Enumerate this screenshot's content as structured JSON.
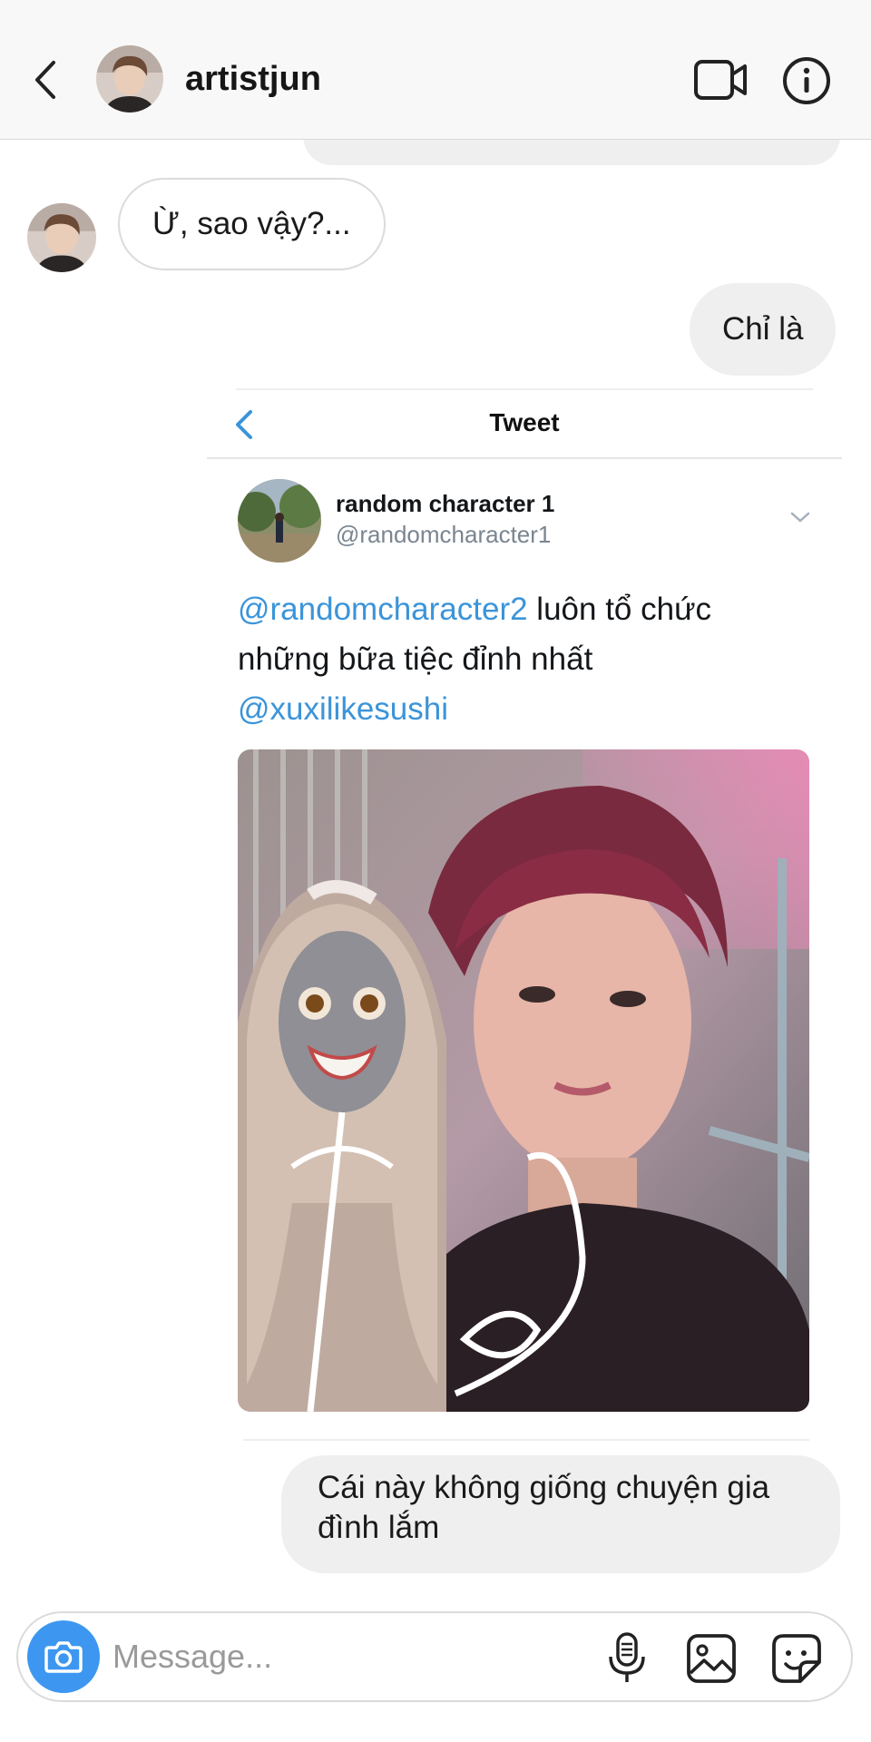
{
  "header": {
    "username": "artistjun",
    "back_icon": "chevron-left-icon",
    "video_icon": "video-call-icon",
    "info_icon": "info-icon"
  },
  "messages": [
    {
      "direction": "incoming",
      "text": "Ừ, sao vậy?..."
    },
    {
      "direction": "outgoing",
      "text": "Chỉ là"
    },
    {
      "direction": "outgoing",
      "text": "Cái này không giống chuyện gia đình lắm"
    }
  ],
  "tweet": {
    "nav_title": "Tweet",
    "display_name": "random character 1",
    "handle": "@randomcharacter1",
    "mention1": "@randomcharacter2",
    "text_part1": " luôn tổ chức những bữa tiệc đỉnh nhất",
    "mention2": "@xuxilikesushi"
  },
  "composer": {
    "placeholder": "Message...",
    "camera_icon": "camera-icon",
    "mic_icon": "microphone-icon",
    "gallery_icon": "gallery-icon",
    "sticker_icon": "sticker-icon"
  },
  "colors": {
    "accent_blue": "#3d97f0",
    "mention_blue": "#3b94d9",
    "bubble_gray": "#efefef"
  }
}
